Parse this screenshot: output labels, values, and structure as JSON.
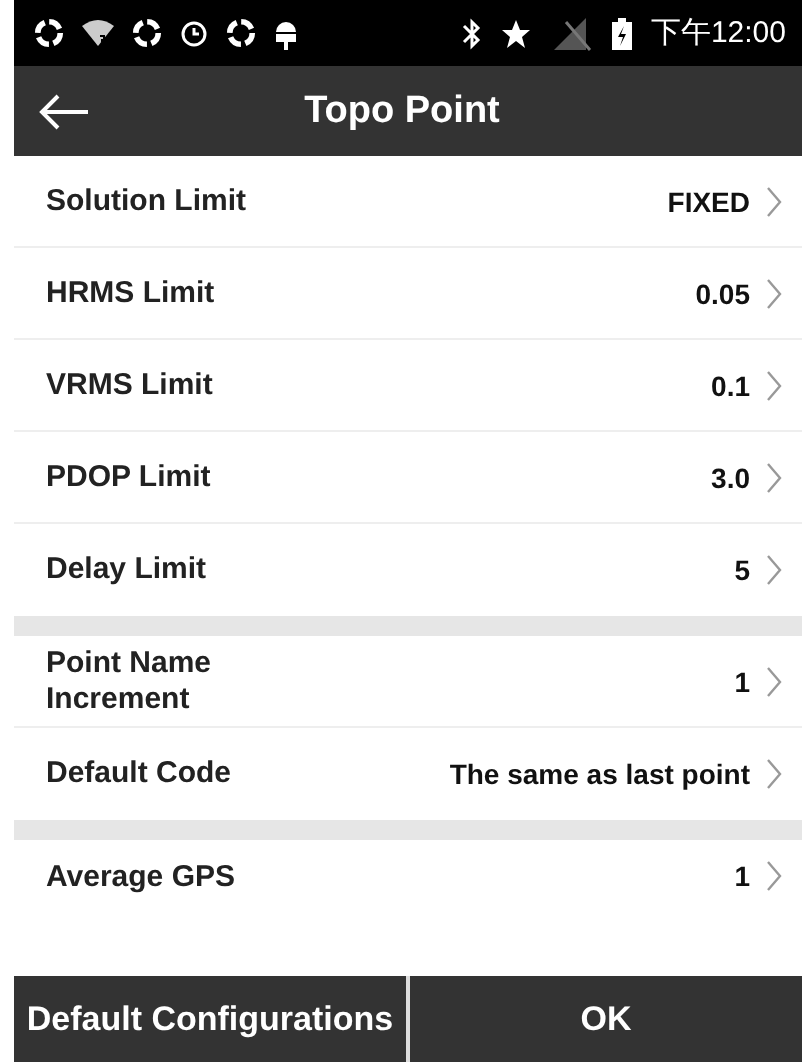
{
  "status_bar": {
    "time": "下午12:00"
  },
  "app_bar": {
    "title": "Topo Point"
  },
  "groups": [
    {
      "rows": [
        {
          "label": "Solution Limit",
          "value": "FIXED"
        },
        {
          "label": "HRMS Limit",
          "value": "0.05"
        },
        {
          "label": "VRMS Limit",
          "value": "0.1"
        },
        {
          "label": "PDOP Limit",
          "value": "3.0"
        },
        {
          "label": "Delay Limit",
          "value": "5"
        }
      ]
    },
    {
      "rows": [
        {
          "label": "Point Name Increment",
          "value": "1"
        },
        {
          "label": "Default Code",
          "value": "The same as last point"
        }
      ]
    },
    {
      "rows": [
        {
          "label": "Average GPS",
          "value": "1"
        }
      ]
    }
  ],
  "buttons": [
    {
      "label": "Default Configurations"
    },
    {
      "label": "OK"
    }
  ]
}
